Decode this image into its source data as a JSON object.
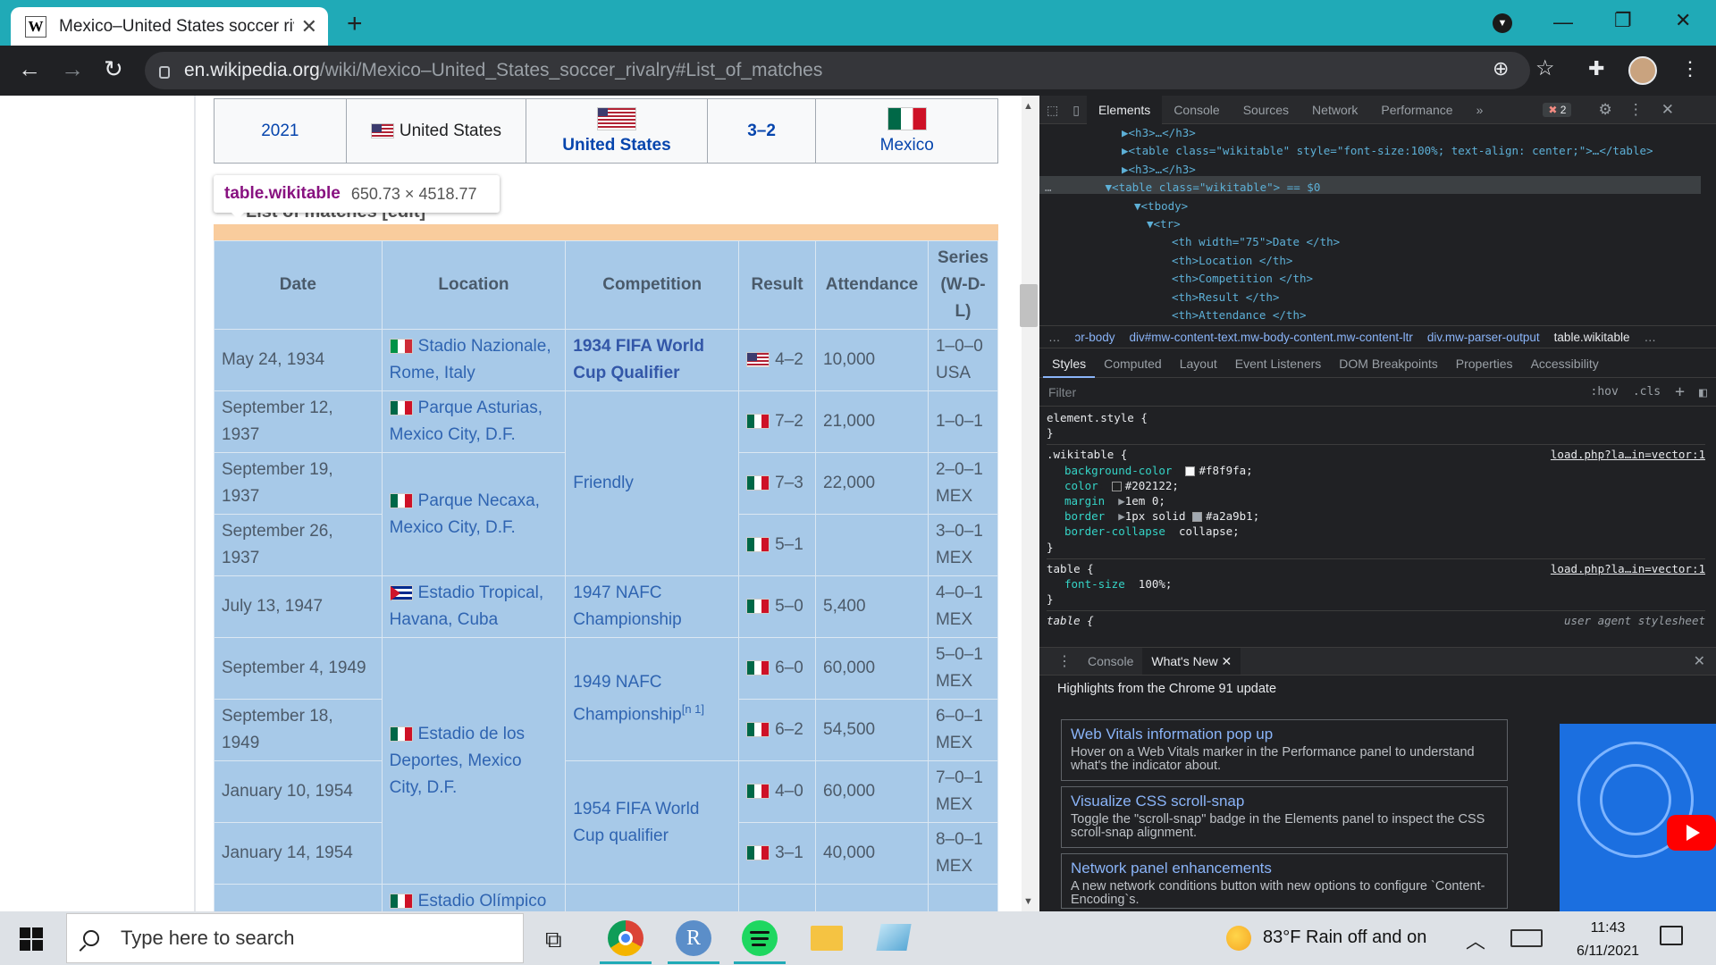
{
  "browser": {
    "tab_title": "Mexico–United States soccer rivalry - Wikipedia",
    "favicon": "W",
    "new_tab": "+",
    "url_host": "en.wikipedia.org",
    "url_path": "/wiki/Mexico–United_States_soccer_rivalry#List_of_matches"
  },
  "top_row": {
    "year": "2021",
    "location": "United States",
    "winner": "United States",
    "score": "3–2",
    "runner_up": "Mexico"
  },
  "tooltip": {
    "tag": "table.wikitable",
    "dims": "650.73 × 4518.77"
  },
  "section_peek": "List of matches [edit]",
  "table": {
    "headers": [
      "Date",
      "Location",
      "Competition",
      "Result",
      "Attendance",
      "Series (W-D-L)"
    ],
    "rows": [
      {
        "date": "May 24, 1934",
        "location": "Stadio Nazionale, Rome, Italy",
        "competition": "1934 FIFA World Cup Qualifier",
        "result": "4–2",
        "attendance": "10,000",
        "series": "1–0–0 USA"
      },
      {
        "date": "September 12, 1937",
        "location": "Parque Asturias, Mexico City, D.F.",
        "competition": "Friendly",
        "result": "7–2",
        "attendance": "21,000",
        "series": "1–0–1"
      },
      {
        "date": "September 19, 1937",
        "location": "Parque Necaxa, Mexico City, D.F.",
        "result": "7–3",
        "attendance": "22,000",
        "series": "2–0–1 MEX"
      },
      {
        "date": "September 26, 1937",
        "result": "5–1",
        "attendance": "",
        "series": "3–0–1 MEX"
      },
      {
        "date": "July 13, 1947",
        "location": "Estadio Tropical, Havana, Cuba",
        "competition": "1947 NAFC Championship",
        "result": "5–0",
        "attendance": "5,400",
        "series": "4–0–1 MEX"
      },
      {
        "date": "September 4, 1949",
        "location": "Estadio de los Deportes, Mexico City, D.F.",
        "competition": "1949 NAFC Championship",
        "competition_note": "[n 1]",
        "result": "6–0",
        "attendance": "60,000",
        "series": "5–0–1 MEX"
      },
      {
        "date": "September 18, 1949",
        "result": "6–2",
        "attendance": "54,500",
        "series": "6–0–1 MEX"
      },
      {
        "date": "January 10, 1954",
        "competition": "1954 FIFA World Cup qualifier",
        "result": "4–0",
        "attendance": "60,000",
        "series": "7–0–1 MEX"
      },
      {
        "date": "January 14, 1954",
        "result": "3–1",
        "attendance": "40,000",
        "series": "8–0–1 MEX"
      },
      {
        "date": "",
        "location": "Estadio Olímpico",
        "result": "",
        "attendance": "",
        "series": ""
      }
    ]
  },
  "devtools": {
    "tabs": [
      "Elements",
      "Console",
      "Sources",
      "Network",
      "Performance",
      "»"
    ],
    "error_count": "2",
    "tree": [
      "▶<h3>…</h3>",
      "▶<table class=\"wikitable\" style=\"font-size:100%; text-align: center;\">…</table>",
      "▶<h3>…</h3>",
      "▼<table class=\"wikitable\"> == $0",
      "▼<tbody>",
      "▼<tr>",
      "<th width=\"75\">Date </th>",
      "<th>Location </th>",
      "<th>Competition </th>",
      "<th>Result </th>",
      "<th>Attendance </th>"
    ],
    "breadcrumbs": [
      "…",
      "ɔr-body",
      "div#mw-content-text.mw-body-content.mw-content-ltr",
      "div.mw-parser-output",
      "table.wikitable",
      "…"
    ],
    "style_tabs": [
      "Styles",
      "Computed",
      "Layout",
      "Event Listeners",
      "DOM Breakpoints",
      "Properties",
      "Accessibility"
    ],
    "filter_placeholder": "Filter",
    "hov": ":hov",
    "cls": ".cls",
    "rules": {
      "element_style": "element.style {",
      "wikitable_sel": ".wikitable {",
      "wikitable_src": "load.php?la…in=vector:1",
      "bg_name": "background-color",
      "bg_val": "#f8f9fa;",
      "color_name": "color",
      "color_val": "#202122;",
      "margin_name": "margin",
      "margin_val": "1em 0;",
      "border_name": "border",
      "border_val": "1px solid",
      "border_color": "#a2a9b1;",
      "collapse_name": "border-collapse",
      "collapse_val": "collapse;",
      "table_sel": "table {",
      "table_src": "load.php?la…in=vector:1",
      "fs_name": "font-size",
      "fs_val": "100%;",
      "ua_sel": "table {",
      "ua_src": "user agent stylesheet",
      "close": "}"
    },
    "drawer_tabs": [
      "Console",
      "What's New"
    ],
    "whatsnew_head": "Highlights from the Chrome 91 update",
    "cards": [
      {
        "title": "Web Vitals information pop up",
        "desc": "Hover on a Web Vitals marker in the Performance panel to understand what's the indicator about."
      },
      {
        "title": "Visualize CSS scroll-snap",
        "desc": "Toggle the \"scroll-snap\" badge in the Elements panel to inspect the CSS scroll-snap alignment."
      },
      {
        "title": "Network panel enhancements",
        "desc": "A new network conditions button with new options to configure `Content-Encoding`s."
      }
    ]
  },
  "taskbar": {
    "search_placeholder": "Type here to search",
    "weather": "83°F  Rain off and on",
    "time": "11:43",
    "date": "6/11/2021"
  },
  "colors": {
    "tab_strip": "#20aab7",
    "toolbar": "#202124",
    "table_highlight": "#a7c9e8",
    "orange_margin": "#f9cc9d"
  }
}
